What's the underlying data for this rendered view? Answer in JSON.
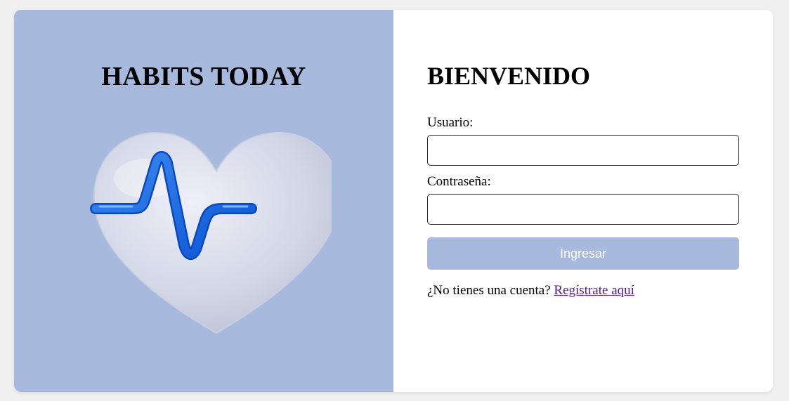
{
  "brand": {
    "title": "HABITS TODAY",
    "illustration_icon": "heart-pulse-icon"
  },
  "login": {
    "heading": "BIENVENIDO",
    "username_label": "Usuario:",
    "username_value": "",
    "password_label": "Contraseña:",
    "password_value": "",
    "submit_label": "Ingresar",
    "signup_prompt": "¿No tienes una cuenta?",
    "signup_link": "Regístrate aquí"
  },
  "colors": {
    "accent": "#a7b9dc",
    "link_visited": "#551a8b",
    "page_background": "#f0f0f0"
  }
}
